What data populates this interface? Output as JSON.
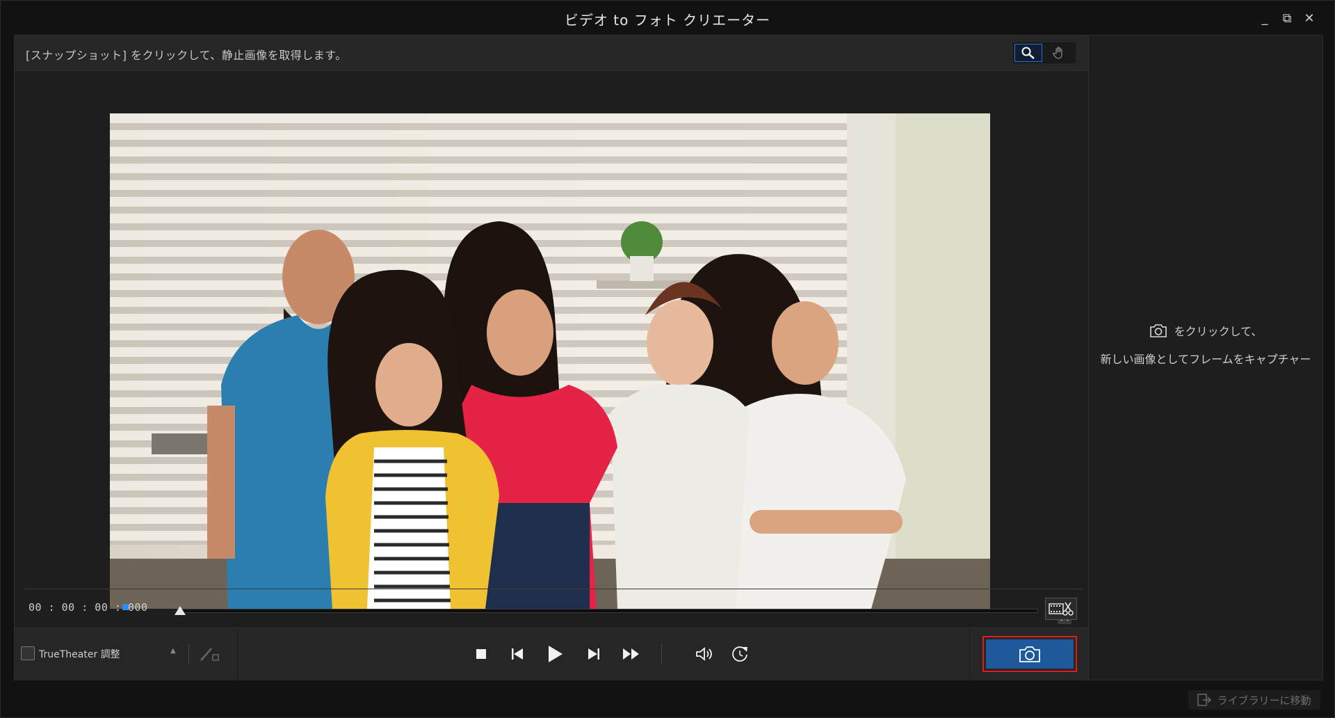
{
  "window": {
    "title": "ビデオ to フォト クリエーター",
    "controls": {
      "minimize": "_",
      "restore": "⧉",
      "close": "✕"
    }
  },
  "hint": {
    "text": "[スナップショット] をクリックして、静止画像を取得します。"
  },
  "tools": {
    "zoom_icon": "magnifier-icon",
    "hand_icon": "hand-icon",
    "active": "zoom"
  },
  "timeline": {
    "timecode": "00 : 00 : 00 : 000",
    "progress": 0.0
  },
  "controls": {
    "truetheater_label": "TrueTheater 調整",
    "truetheater_checked": false,
    "icons": [
      "stop-icon",
      "previous-frame-icon",
      "play-icon",
      "next-frame-icon",
      "fast-forward-icon",
      "volume-icon",
      "rotate-icon"
    ]
  },
  "side_panel": {
    "line1": "をクリックして、",
    "line2": "新しい画像としてフレームをキャプチャー"
  },
  "footer": {
    "library_label": "ライブラリーに移動"
  },
  "colors": {
    "accent_blue": "#1e5a9a",
    "highlight_red": "#e21b1b",
    "marker_blue": "#2d8cf0"
  }
}
